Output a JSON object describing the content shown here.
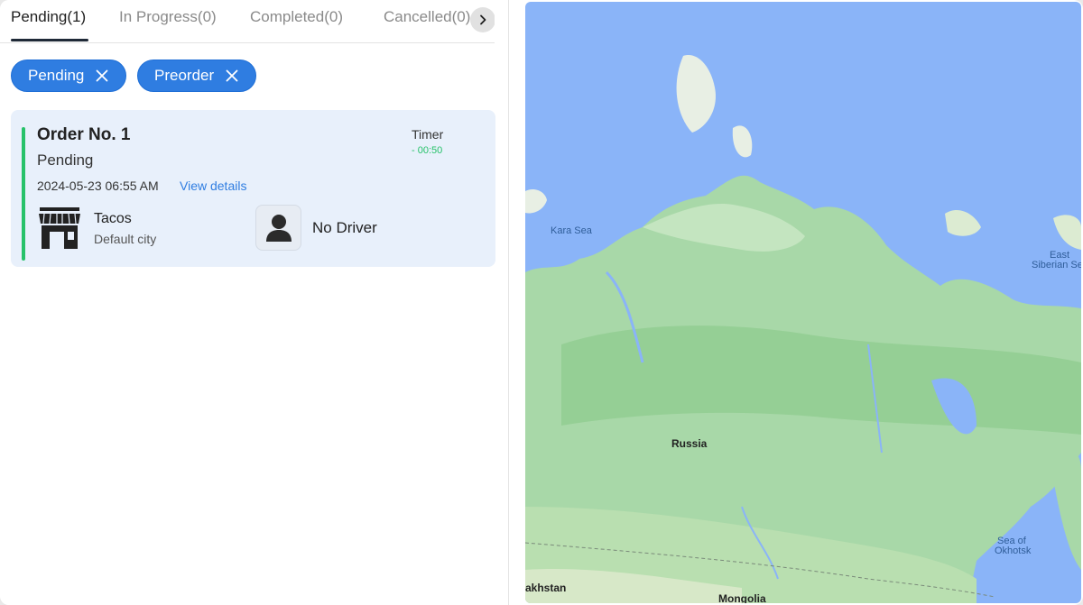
{
  "tabs": [
    {
      "label": "Pending(1)",
      "active": true
    },
    {
      "label": "In Progress(0)",
      "active": false
    },
    {
      "label": "Completed(0)",
      "active": false
    },
    {
      "label": "Cancelled(0)",
      "active": false
    }
  ],
  "filters": [
    {
      "label": "Pending"
    },
    {
      "label": "Preorder"
    }
  ],
  "order": {
    "title": "Order No. 1",
    "status": "Pending",
    "datetime": "2024-05-23 06:55 AM",
    "view_details": "View details",
    "timer_label": "Timer",
    "timer_value": "- 00:50",
    "store_name": "Tacos",
    "store_city": "Default city",
    "driver": "No Driver"
  },
  "map": {
    "labels": {
      "kara_sea": "Kara Sea",
      "east_siberian_1": "East",
      "east_siberian_2": "Siberian Se",
      "russia": "Russia",
      "okhotsk_1": "Sea of",
      "okhotsk_2": "Okhotsk",
      "kazakhstan": "akhstan",
      "mongolia": "Mongolia"
    }
  },
  "colors": {
    "accent": "#2f7de1",
    "success": "#27c26a",
    "card_bg": "#e8f0fb",
    "water": "#8ab4f8",
    "land": "#a8d8a8"
  }
}
